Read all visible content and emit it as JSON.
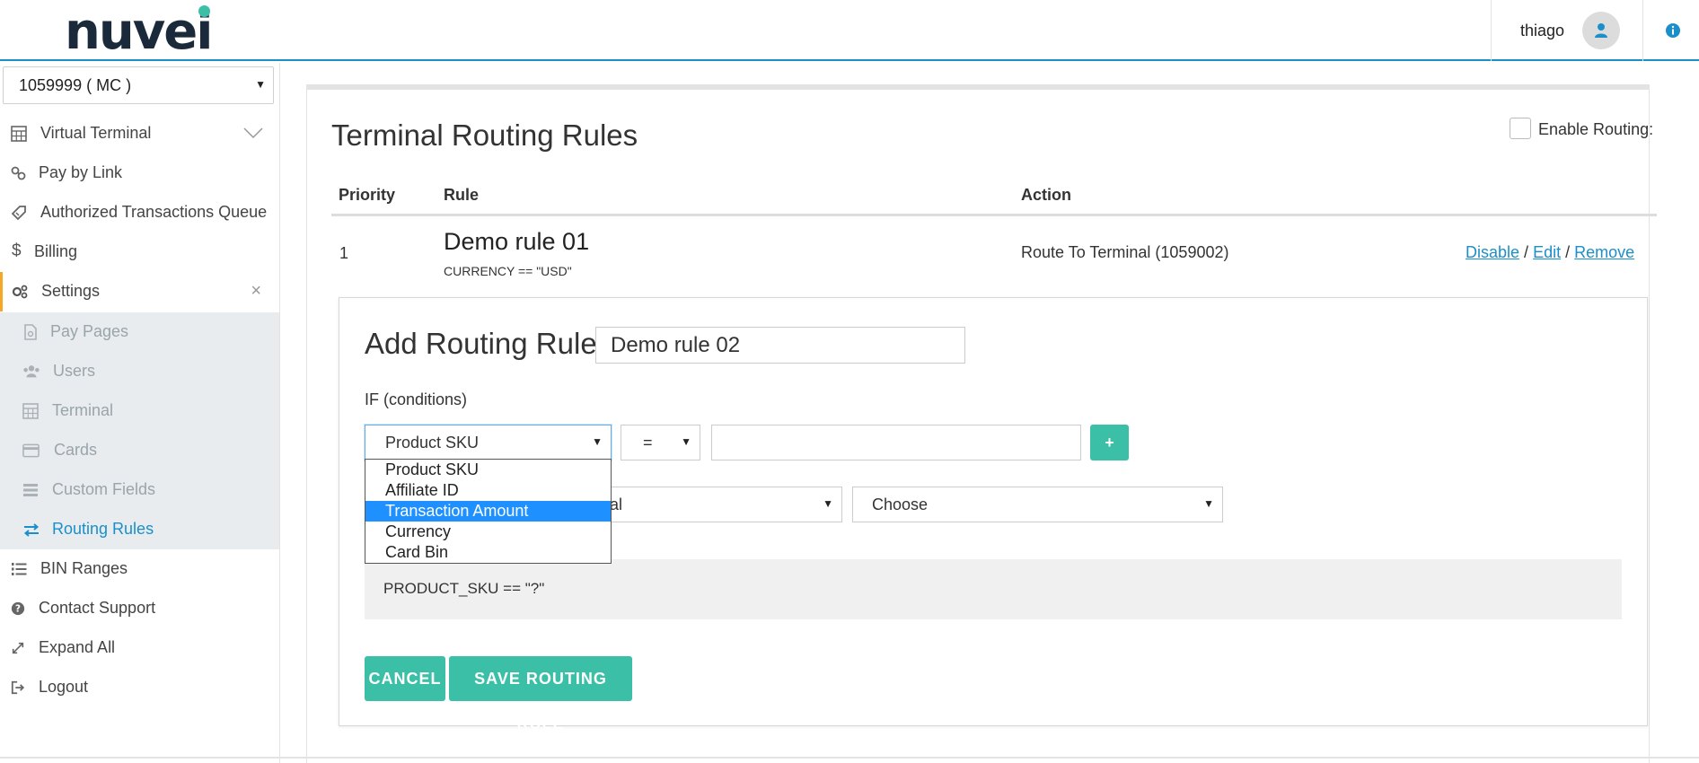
{
  "header": {
    "logo_text": "nuvei",
    "username": "thiago",
    "accent": "#1a8fc9",
    "brand_green": "#3bbfa6"
  },
  "sidebar": {
    "merchant_select": "1059999 ( MC )",
    "items": [
      {
        "label": "Virtual Terminal",
        "icon": "calculator-icon"
      },
      {
        "label": "Pay by Link",
        "icon": "link-icon"
      },
      {
        "label": "Authorized Transactions Queue",
        "icon": "tag-icon"
      },
      {
        "label": "Billing",
        "icon": "dollar-icon"
      },
      {
        "label": "Settings",
        "icon": "gears-icon"
      },
      {
        "label": "Pay Pages",
        "icon": "document-icon"
      },
      {
        "label": "Users",
        "icon": "users-icon"
      },
      {
        "label": "Terminal",
        "icon": "calculator-icon"
      },
      {
        "label": "Cards",
        "icon": "credit-card-icon"
      },
      {
        "label": "Custom Fields",
        "icon": "list-icon"
      },
      {
        "label": "Routing Rules",
        "icon": "exchange-icon"
      },
      {
        "label": "BIN Ranges",
        "icon": "list-ol-icon"
      },
      {
        "label": "Contact Support",
        "icon": "question-circle-icon"
      },
      {
        "label": "Expand All",
        "icon": "expand-icon"
      },
      {
        "label": "Logout",
        "icon": "sign-out-icon"
      }
    ]
  },
  "main": {
    "title": "Terminal Routing Rules",
    "enable_routing_label": "Enable Routing:",
    "table": {
      "headers": [
        "Priority",
        "Rule",
        "Action"
      ],
      "rows": [
        {
          "priority": "1",
          "rule_name": "Demo rule 01",
          "rule_condition": "CURRENCY == \"USD\"",
          "action": "Route To Terminal (1059002)",
          "links": {
            "disable": "Disable",
            "sep1": "/",
            "edit": "Edit",
            "sep2": "/",
            "remove": "Remove"
          }
        }
      ]
    },
    "add_rule": {
      "title": "Add Routing Rule",
      "rule_name_value": "Demo rule 02",
      "if_label": "IF (conditions)",
      "field_select_value": "Product SKU",
      "operator_value": "=",
      "plus_label": "+",
      "action_select_partial": "al",
      "choose_value": "Choose",
      "dropdown_options": [
        "Product SKU",
        "Affiliate ID",
        "Transaction Amount",
        "Currency",
        "Card Bin"
      ],
      "highlighted_option": "Transaction Amount",
      "preview": "PRODUCT_SKU == \"?\"",
      "cancel_label": "CANCEL",
      "save_label": "SAVE ROUTING RULE"
    }
  }
}
